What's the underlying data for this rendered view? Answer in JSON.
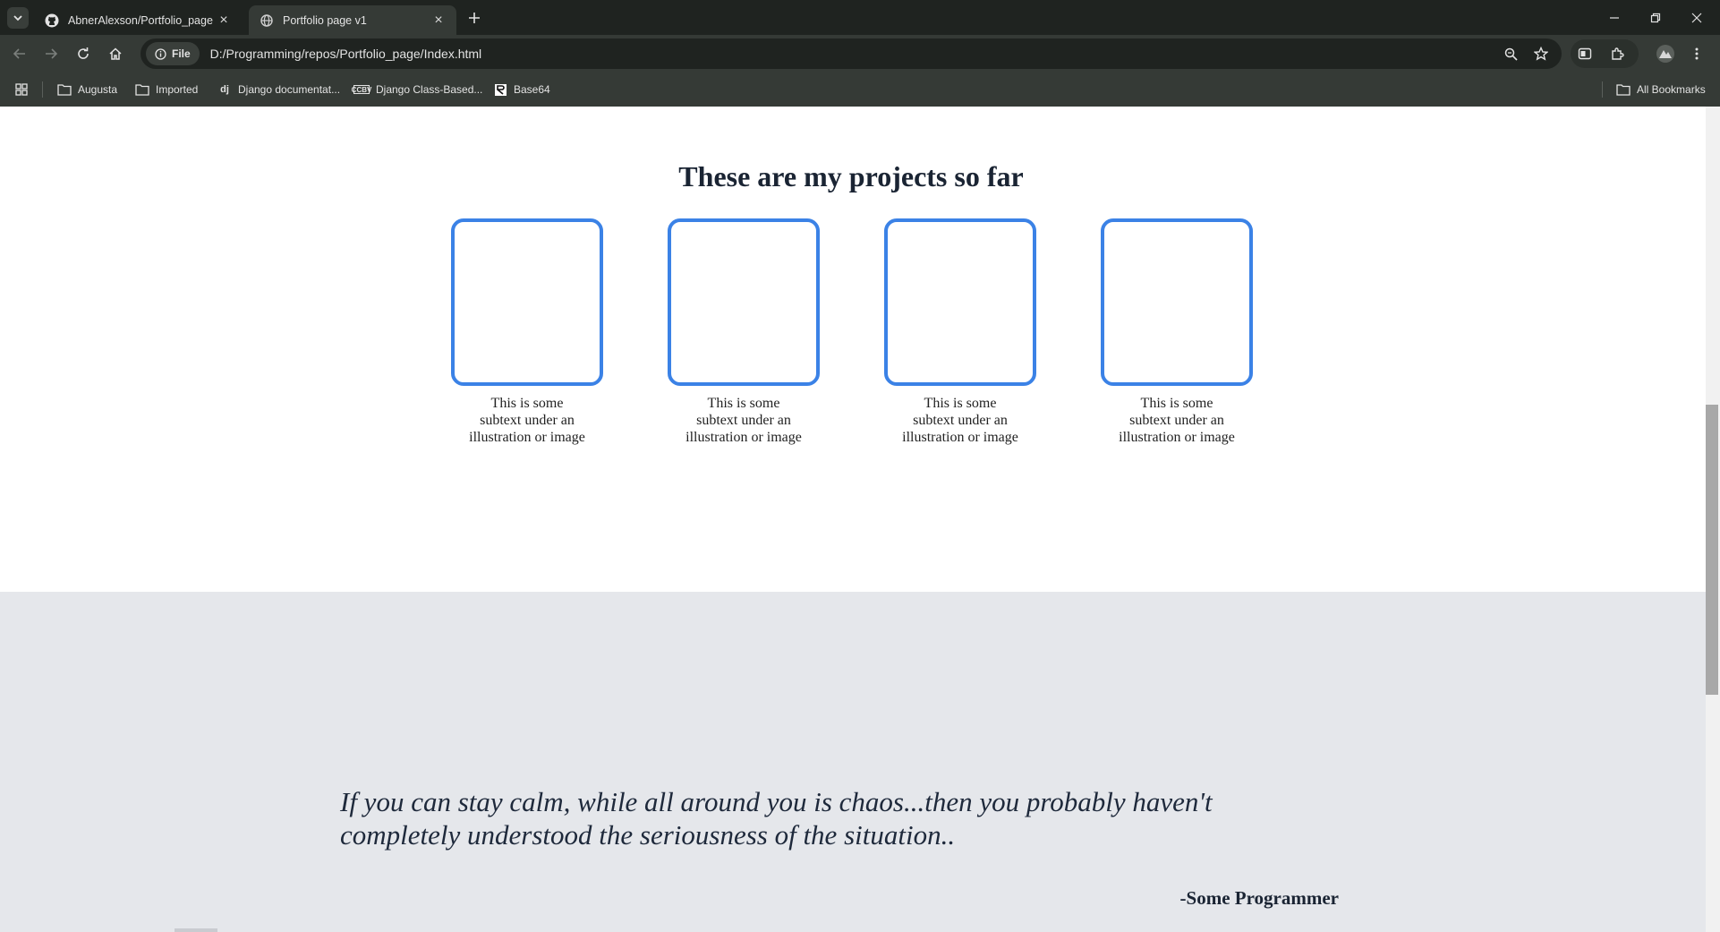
{
  "browser": {
    "tabs": [
      {
        "title": "AbnerAlexson/Portfolio_page",
        "icon": "github-icon",
        "active": false
      },
      {
        "title": "Portfolio page v1",
        "icon": "globe-icon",
        "active": true
      }
    ],
    "address": {
      "chip_label": "File",
      "url": "D:/Programming/repos/Portfolio_page/Index.html"
    },
    "bookmarks": [
      {
        "label": "Augusta",
        "icon": "folder-icon"
      },
      {
        "label": "Imported",
        "icon": "folder-icon"
      },
      {
        "label": "Django documentat...",
        "icon": "django-icon"
      },
      {
        "label": "Django Class-Based...",
        "icon": "ccbv-icon"
      },
      {
        "label": "Base64",
        "icon": "base64-icon"
      }
    ],
    "all_bookmarks_label": "All Bookmarks",
    "colors": {
      "frame": "#1f2320",
      "toolbar": "#353a36",
      "accent": "#3b82e6"
    }
  },
  "page": {
    "projects": {
      "title": "These are my projects so far",
      "cards": [
        {
          "caption": "This is some subtext under an illustration or image"
        },
        {
          "caption": "This is some subtext under an illustration or image"
        },
        {
          "caption": "This is some subtext under an illustration or image"
        },
        {
          "caption": "This is some subtext under an illustration or image"
        }
      ]
    },
    "quote": {
      "text": "If you can stay calm, while all around you is chaos...then you probably haven't completely understood the seriousness of the situation..",
      "author": "-Some Programmer"
    }
  }
}
